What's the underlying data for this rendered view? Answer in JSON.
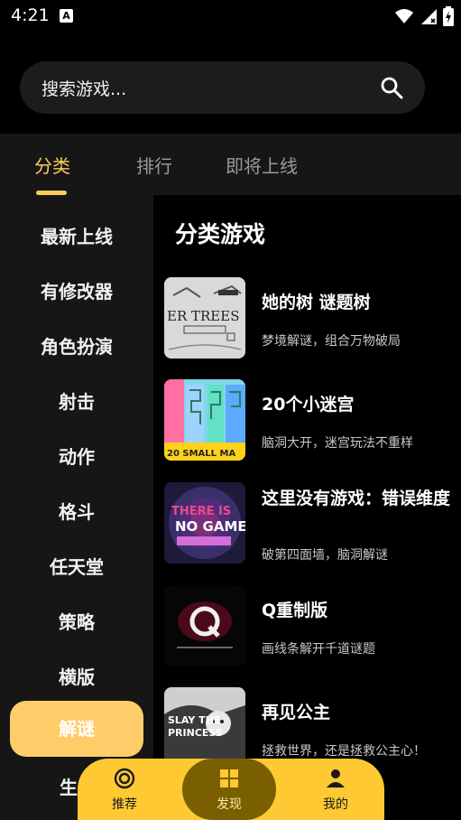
{
  "status_bar": {
    "time": "4:21",
    "notification_icon": "A",
    "icons": [
      "wifi-icon",
      "signal-icon",
      "battery-icon"
    ]
  },
  "search": {
    "placeholder": "搜索游戏..."
  },
  "tabs": [
    {
      "label": "分类",
      "active": true
    },
    {
      "label": "排行",
      "active": false
    },
    {
      "label": "即将上线",
      "active": false
    }
  ],
  "sidebar": {
    "items": [
      {
        "label": "最新上线"
      },
      {
        "label": "有修改器"
      },
      {
        "label": "角色扮演"
      },
      {
        "label": "射击"
      },
      {
        "label": "动作"
      },
      {
        "label": "格斗"
      },
      {
        "label": "任天堂"
      },
      {
        "label": "策略"
      },
      {
        "label": "横版"
      },
      {
        "label": "解谜",
        "active": true
      },
      {
        "label": "生"
      }
    ]
  },
  "content": {
    "title": "分类游戏",
    "games": [
      {
        "name": "她的树 谜题树",
        "desc": "梦境解谜，组合万物破局",
        "thumb_text": "ER TREES"
      },
      {
        "name": "20个小迷宫",
        "desc": "脑洞大开，迷宫玩法不重样",
        "thumb_text": "20 SMALL MA"
      },
      {
        "name": "这里没有游戏：错误维度",
        "desc": "破第四面墙，脑洞解谜",
        "thumb_text": "THERE IS NO GAME"
      },
      {
        "name": "Q重制版",
        "desc": "画线条解开千道谜题",
        "thumb_text": "Q"
      },
      {
        "name": "再见公主",
        "desc": "拯救世界，还是拯救公主心！",
        "thumb_text": "SLAY THE PRINCESS"
      }
    ]
  },
  "bottom_nav": [
    {
      "label": "推荐",
      "icon": "target-icon"
    },
    {
      "label": "发现",
      "icon": "grid-icon",
      "active": true
    },
    {
      "label": "我的",
      "icon": "person-icon"
    }
  ],
  "colors": {
    "accent": "#ffcc5a",
    "nav_bg": "#ffc933",
    "active_nav": "#7a5f00"
  }
}
